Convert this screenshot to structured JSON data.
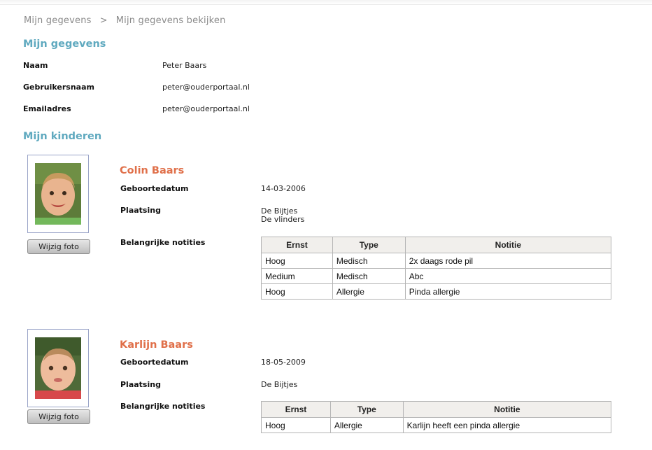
{
  "breadcrumb": {
    "items": [
      "Mijn gegevens",
      "Mijn gegevens bekijken"
    ],
    "separator": ">"
  },
  "profile": {
    "title": "Mijn gegevens",
    "fields": [
      {
        "label": "Naam",
        "value": "Peter Baars"
      },
      {
        "label": "Gebruikersnaam",
        "value": "peter@ouderportaal.nl"
      },
      {
        "label": "Emailadres",
        "value": "peter@ouderportaal.nl"
      }
    ]
  },
  "children_section": {
    "title": "Mijn kinderen"
  },
  "children": [
    {
      "name": "Colin Baars",
      "photo_button": "Wijzig foto",
      "birthdate_label": "Geboortedatum",
      "birthdate": "14-03-2006",
      "placement_label": "Plaatsing",
      "placements": [
        "De Bijtjes",
        "De vlinders"
      ],
      "notes_label": "Belangrijke notities",
      "notes_headers": [
        "Ernst",
        "Type",
        "Notitie"
      ],
      "notes": [
        [
          "Hoog",
          "Medisch",
          "2x daags rode pil"
        ],
        [
          "Medium",
          "Medisch",
          "Abc"
        ],
        [
          "Hoog",
          "Allergie",
          "Pinda allergie"
        ]
      ]
    },
    {
      "name": "Karlijn Baars",
      "photo_button": "Wijzig foto",
      "birthdate_label": "Geboortedatum",
      "birthdate": "18-05-2009",
      "placement_label": "Plaatsing",
      "placements": [
        "De Bijtjes"
      ],
      "notes_label": "Belangrijke notities",
      "notes_headers": [
        "Ernst",
        "Type",
        "Notitie"
      ],
      "notes": [
        [
          "Hoog",
          "Allergie",
          "Karlijn heeft een pinda allergie"
        ]
      ]
    }
  ]
}
